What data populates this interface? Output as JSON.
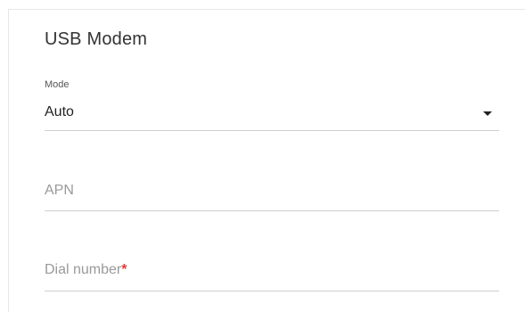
{
  "card": {
    "title": "USB Modem"
  },
  "fields": {
    "mode": {
      "label": "Mode",
      "value": "Auto",
      "icon": "caret-down-icon"
    },
    "apn": {
      "placeholder": "APN"
    },
    "dial_number": {
      "placeholder": "Dial number",
      "required_mark": "*"
    }
  },
  "colors": {
    "required": "#e53935",
    "divider": "#cfcfcf",
    "placeholder": "#9a9a9a"
  }
}
